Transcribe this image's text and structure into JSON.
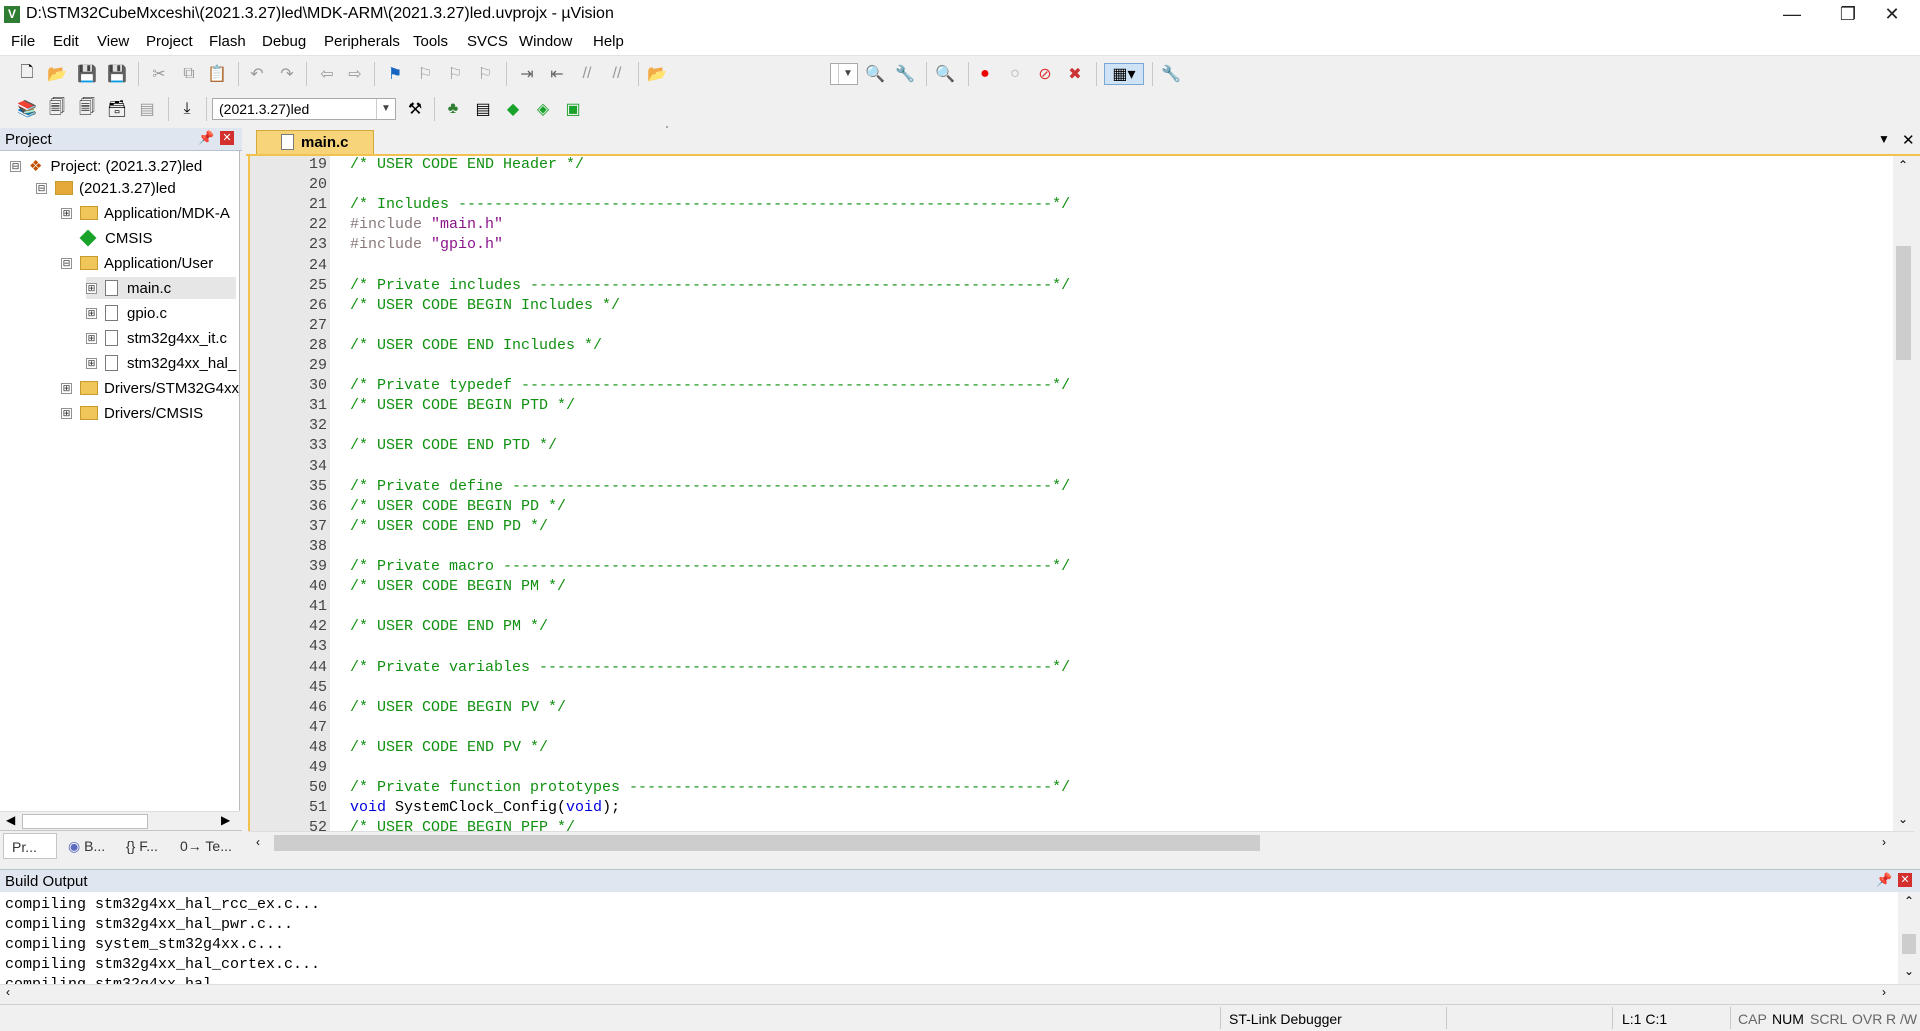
{
  "window": {
    "title": "D:\\STM32CubeMxceshi\\(2021.3.27)led\\MDK-ARM\\(2021.3.27)led.uvprojx - µVision",
    "minimize_glyph": "—",
    "restore_glyph": "❐",
    "close_glyph": "✕"
  },
  "menu": [
    "File",
    "Edit",
    "View",
    "Project",
    "Flash",
    "Debug",
    "Peripherals",
    "Tools",
    "SVCS",
    "Window",
    "Help"
  ],
  "toolbar2": {
    "target_value": "(2021.3.27)led"
  },
  "project_panel": {
    "title": "Project",
    "tree": [
      {
        "label": "Project: (2021.3.27)led",
        "icon": "project-icon",
        "expander": "⊟"
      },
      {
        "label": "(2021.3.27)led",
        "icon": "target-folder-icon",
        "expander": "⊟"
      },
      {
        "label": "Application/MDK-A",
        "icon": "folder-icon",
        "expander": "⊞"
      },
      {
        "label": "CMSIS",
        "icon": "cmsis-gem-icon",
        "expander": ""
      },
      {
        "label": "Application/User",
        "icon": "folder-open-icon",
        "expander": "⊟"
      },
      {
        "label": "main.c",
        "icon": "file-icon",
        "expander": "⊞"
      },
      {
        "label": "gpio.c",
        "icon": "file-icon",
        "expander": "⊞"
      },
      {
        "label": "stm32g4xx_it.c",
        "icon": "file-icon",
        "expander": "⊞"
      },
      {
        "label": "stm32g4xx_hal_",
        "icon": "file-icon",
        "expander": "⊞"
      },
      {
        "label": "Drivers/STM32G4xx_",
        "icon": "folder-icon",
        "expander": "⊞"
      },
      {
        "label": "Drivers/CMSIS",
        "icon": "folder-icon",
        "expander": "⊞"
      }
    ],
    "tabs": [
      "Pr...",
      "B...",
      "{} F...",
      "0→ Te..."
    ]
  },
  "editor": {
    "active_tab": "main.c",
    "lines": [
      {
        "n": "19",
        "t": "/* USER CODE END Header */"
      },
      {
        "n": "20",
        "t": ""
      },
      {
        "n": "21",
        "t": "/* Includes ------------------------------------------------------------------*/"
      },
      {
        "n": "22",
        "t": "#include \"main.h\""
      },
      {
        "n": "23",
        "t": "#include \"gpio.h\""
      },
      {
        "n": "24",
        "t": ""
      },
      {
        "n": "25",
        "t": "/* Private includes ----------------------------------------------------------*/"
      },
      {
        "n": "26",
        "t": "/* USER CODE BEGIN Includes */"
      },
      {
        "n": "27",
        "t": ""
      },
      {
        "n": "28",
        "t": "/* USER CODE END Includes */"
      },
      {
        "n": "29",
        "t": ""
      },
      {
        "n": "30",
        "t": "/* Private typedef -----------------------------------------------------------*/"
      },
      {
        "n": "31",
        "t": "/* USER CODE BEGIN PTD */"
      },
      {
        "n": "32",
        "t": ""
      },
      {
        "n": "33",
        "t": "/* USER CODE END PTD */"
      },
      {
        "n": "34",
        "t": ""
      },
      {
        "n": "35",
        "t": "/* Private define ------------------------------------------------------------*/"
      },
      {
        "n": "36",
        "t": "/* USER CODE BEGIN PD */"
      },
      {
        "n": "37",
        "t": "/* USER CODE END PD */"
      },
      {
        "n": "38",
        "t": ""
      },
      {
        "n": "39",
        "t": "/* Private macro -------------------------------------------------------------*/"
      },
      {
        "n": "40",
        "t": "/* USER CODE BEGIN PM */"
      },
      {
        "n": "41",
        "t": ""
      },
      {
        "n": "42",
        "t": "/* USER CODE END PM */"
      },
      {
        "n": "43",
        "t": ""
      },
      {
        "n": "44",
        "t": "/* Private variables ---------------------------------------------------------*/"
      },
      {
        "n": "45",
        "t": ""
      },
      {
        "n": "46",
        "t": "/* USER CODE BEGIN PV */"
      },
      {
        "n": "47",
        "t": ""
      },
      {
        "n": "48",
        "t": "/* USER CODE END PV */"
      },
      {
        "n": "49",
        "t": ""
      },
      {
        "n": "50",
        "t": "/* Private function prototypes -----------------------------------------------*/"
      },
      {
        "n": "51",
        "t": "void SystemClock_Config(void);"
      },
      {
        "n": "52",
        "t": "/* USER CODE BEGIN PFP */"
      }
    ]
  },
  "build_output": {
    "title": "Build Output",
    "lines": [
      "compiling stm32g4xx_hal_rcc_ex.c...",
      "compiling stm32g4xx_hal_pwr.c...",
      "compiling system_stm32g4xx.c...",
      "compiling stm32g4xx_hal_cortex.c...",
      "compiling stm32g4xx_hal..."
    ]
  },
  "status": {
    "debugger": "ST-Link Debugger",
    "position": "L:1 C:1",
    "indicators": [
      "CAP",
      "NUM",
      "SCRL",
      "OVR",
      "R /W"
    ]
  },
  "colors": {
    "comment": "#109010",
    "preprocessor": "#8a7a7a",
    "string": "#8a148a",
    "keyword": "#0000e0",
    "active_tab": "#f7d47a"
  }
}
